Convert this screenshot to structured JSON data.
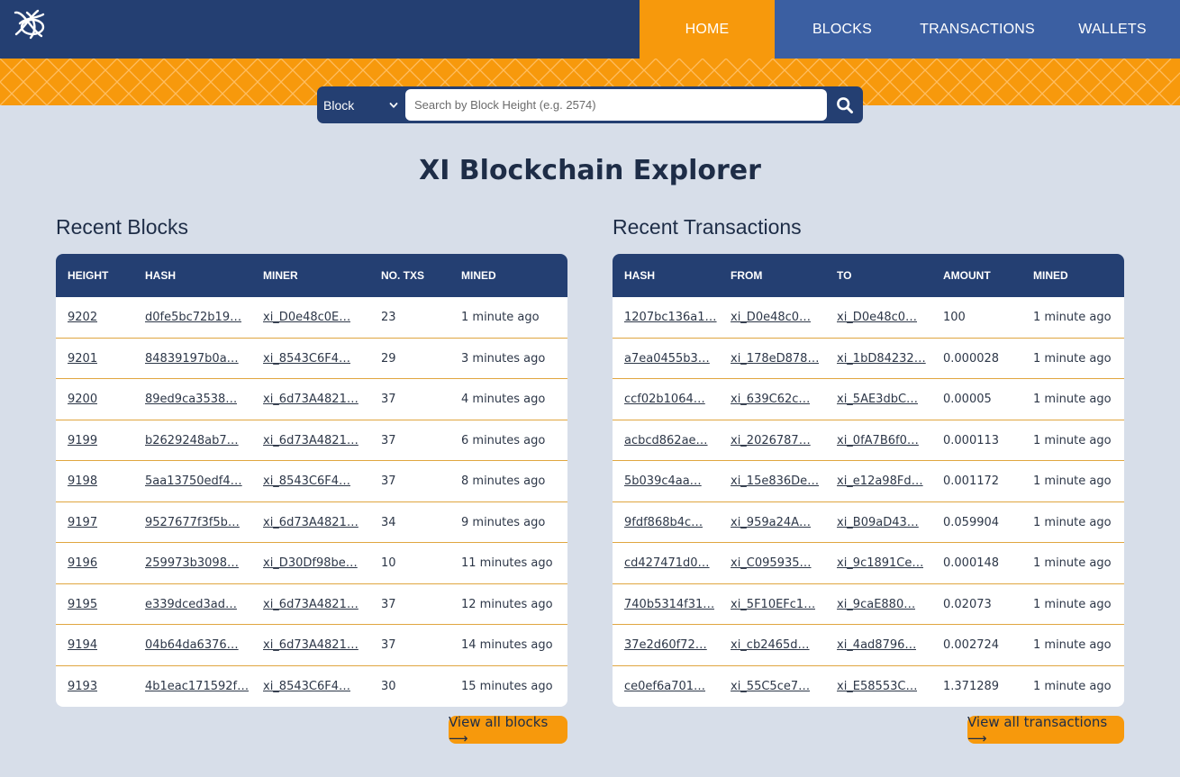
{
  "nav": {
    "items": [
      {
        "label": "HOME",
        "active": true
      },
      {
        "label": "BLOCKS",
        "active": false
      },
      {
        "label": "TRANSACTIONS",
        "active": false
      },
      {
        "label": "WALLETS",
        "active": false
      }
    ]
  },
  "search": {
    "type_value": "Block",
    "placeholder": "Search by Block Height (e.g. 2574)"
  },
  "title": "XI Blockchain Explorer",
  "blocks": {
    "title": "Recent Blocks",
    "columns": [
      "HEIGHT",
      "HASH",
      "MINER",
      "NO. TXS",
      "MINED"
    ],
    "rows": [
      [
        "9202",
        "d0fe5bc72b19…",
        "xi_D0e48c0E…",
        "23",
        "1 minute ago"
      ],
      [
        "9201",
        "84839197b0a…",
        "xi_8543C6F4…",
        "29",
        "3 minutes ago"
      ],
      [
        "9200",
        "89ed9ca3538…",
        "xi_6d73A4821…",
        "37",
        "4 minutes ago"
      ],
      [
        "9199",
        "b2629248ab7…",
        "xi_6d73A4821…",
        "37",
        "6 minutes ago"
      ],
      [
        "9198",
        "5aa13750edf4…",
        "xi_8543C6F4…",
        "37",
        "8 minutes ago"
      ],
      [
        "9197",
        "9527677f3f5b…",
        "xi_6d73A4821…",
        "34",
        "9 minutes ago"
      ],
      [
        "9196",
        "259973b3098…",
        "xi_D30Df98be…",
        "10",
        "11 minutes ago"
      ],
      [
        "9195",
        "e339dced3ad…",
        "xi_6d73A4821…",
        "37",
        "12 minutes ago"
      ],
      [
        "9194",
        "04b64da6376…",
        "xi_6d73A4821…",
        "37",
        "14 minutes ago"
      ],
      [
        "9193",
        "4b1eac171592f…",
        "xi_8543C6F4…",
        "30",
        "15 minutes ago"
      ]
    ],
    "view_all": "View all blocks ⟶"
  },
  "transactions": {
    "title": "Recent Transactions",
    "columns": [
      "HASH",
      "FROM",
      "TO",
      "AMOUNT",
      "MINED"
    ],
    "rows": [
      [
        "1207bc136a1…",
        "xi_D0e48c0…",
        "xi_D0e48c0…",
        "100",
        "1 minute ago"
      ],
      [
        "a7ea0455b3…",
        "xi_178eD878…",
        "xi_1bD84232…",
        "0.000028",
        "1 minute ago"
      ],
      [
        "ccf02b1064…",
        "xi_639C62c…",
        "xi_5AE3dbC…",
        "0.00005",
        "1 minute ago"
      ],
      [
        "acbcd862ae…",
        "xi_2026787…",
        "xi_0fA7B6f0…",
        "0.000113",
        "1 minute ago"
      ],
      [
        "5b039c4aa…",
        "xi_15e836De…",
        "xi_e12a98Fd…",
        "0.001172",
        "1 minute ago"
      ],
      [
        "9fdf868b4c…",
        "xi_959a24A…",
        "xi_B09aD43…",
        "0.059904",
        "1 minute ago"
      ],
      [
        "cd427471d0…",
        "xi_C095935…",
        "xi_9c1891Ce…",
        "0.000148",
        "1 minute ago"
      ],
      [
        "740b5314f31…",
        "xi_5F10EFc1…",
        "xi_9caE880…",
        "0.02073",
        "1 minute ago"
      ],
      [
        "37e2d60f72…",
        "xi_cb2465d…",
        "xi_4ad8796…",
        "0.002724",
        "1 minute ago"
      ],
      [
        "ce0ef6a701…",
        "xi_55C5ce7…",
        "xi_E58553C…",
        "1.371289",
        "1 minute ago"
      ]
    ],
    "view_all": "View all transactions ⟶"
  },
  "colors": {
    "navy": "#243f72",
    "nav_blue": "#3b5fa2",
    "accent_orange": "#f7990c",
    "page_bg": "#d7dee9"
  },
  "icons": {
    "logo": "xi-logo-icon",
    "dropdown": "chevron-down-icon",
    "search": "search-icon"
  }
}
